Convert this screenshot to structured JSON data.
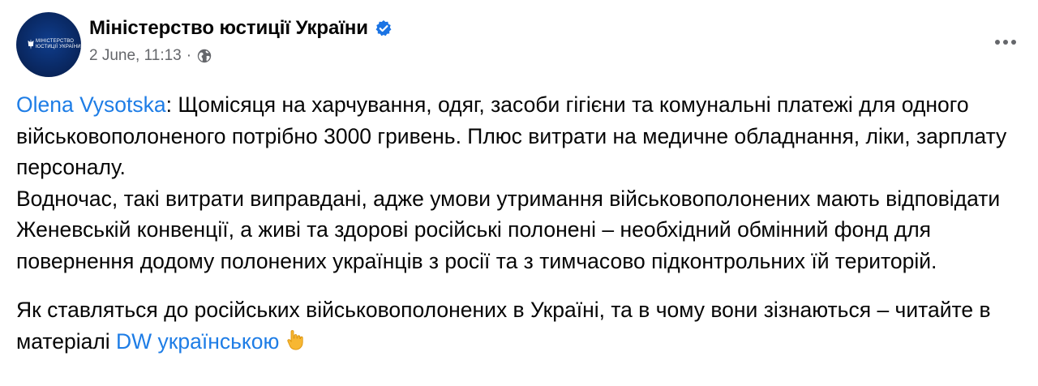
{
  "post": {
    "page_name": "Міністерство юстиції України",
    "avatar_text": "МІНІСТЕРСТВО\nЮСТИЦІЇ УКРАЇНИ",
    "date": "2 June, 11:13",
    "separator": "·",
    "audience_icon": "globe-icon",
    "verified_icon": "verified-badge-icon",
    "more_icon": "more-options-icon"
  },
  "body": {
    "mention": "Olena Vysotska",
    "para1_text": ": Щомісяця на харчування, одяг, засоби гігієни та комунальні платежі для одного військовополоненого потрібно 3000 гривень. Плюс витрати на медичне обладнання, ліки, зарплату персоналу.",
    "para2_text": "Водночас, такі витрати виправдані, адже умови утримання військовополонених мають відповідати Женевській конвенції, а живі та здорові російські полонені – необхідний обмінний фонд для повернення додому полонених українців з росії та з тимчасово підконтрольних їй територій.",
    "para3_text": "Як ставляться до російських військовополонених в Україні, та в чому вони зізнаються – читайте в матеріалі ",
    "link_text": "DW українською",
    "emoji": "pointing-down-hand-emoji"
  },
  "colors": {
    "link": "#1e7de6",
    "verified": "#1b74e4",
    "meta": "#65676b",
    "text": "#050505"
  }
}
